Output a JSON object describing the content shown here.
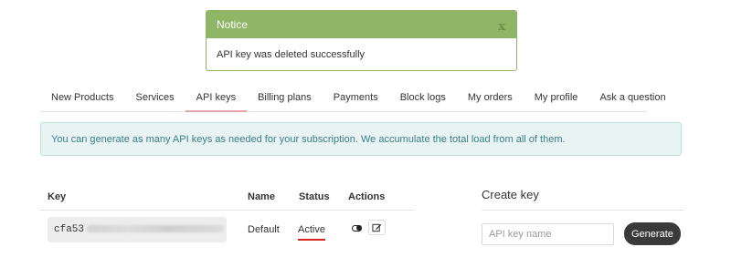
{
  "notice": {
    "title": "Notice",
    "close_label": "x",
    "message": "API key was deleted successfully"
  },
  "tabs": [
    {
      "label": "New Products"
    },
    {
      "label": "Services"
    },
    {
      "label": "API keys",
      "active": true
    },
    {
      "label": "Billing plans"
    },
    {
      "label": "Payments"
    },
    {
      "label": "Block logs"
    },
    {
      "label": "My orders"
    },
    {
      "label": "My profile"
    },
    {
      "label": "Ask a question"
    }
  ],
  "info": {
    "text": "You can generate as many API keys as needed for your subscription. We accumulate the total load from all of them."
  },
  "keys_table": {
    "headers": {
      "key": "Key",
      "name": "Name",
      "status": "Status",
      "actions": "Actions"
    },
    "rows": [
      {
        "key_prefix": "cfa53",
        "name": "Default",
        "status": "Active",
        "actions": [
          "toggle-icon",
          "edit-icon"
        ]
      }
    ]
  },
  "create_key": {
    "title": "Create key",
    "input_placeholder": "API key name",
    "input_value": "",
    "button_label": "Generate"
  },
  "colors": {
    "notice_green": "#8fb567",
    "info_bg": "#e8f4f4",
    "info_text": "#3c7e86",
    "status_underline": "#d9251d",
    "button_dark": "#3a3a3a"
  }
}
